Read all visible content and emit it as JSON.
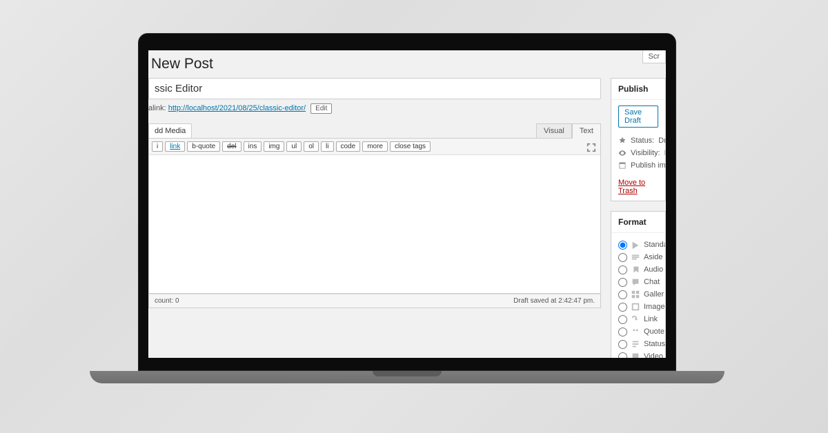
{
  "page": {
    "heading": "New Post",
    "screen_options": "Scr"
  },
  "post": {
    "title": "ssic Editor",
    "permalink_label": "alink:",
    "permalink_url": "http://localhost/2021/08/25/classic-editor/",
    "edit_label": "Edit"
  },
  "media": {
    "add_label": "dd Media"
  },
  "tabs": {
    "visual": "Visual",
    "text": "Text"
  },
  "toolbar": {
    "buttons": [
      "i",
      "link",
      "b-quote",
      "del",
      "ins",
      "img",
      "ul",
      "ol",
      "li",
      "code",
      "more",
      "close tags"
    ]
  },
  "status": {
    "word_count": "count: 0",
    "draft_saved": "Draft saved at 2:42:47 pm."
  },
  "publish": {
    "title": "Publish",
    "save_draft": "Save Draft",
    "status_label": "Status:",
    "status_value": "Dra",
    "visibility_label": "Visibility:",
    "visibility_value": "P",
    "publish_label": "Publish im",
    "trash": "Move to Trash"
  },
  "format": {
    "title": "Format",
    "options": [
      "Standa",
      "Aside",
      "Audio",
      "Chat",
      "Galler",
      "Image",
      "Link",
      "Quote",
      "Status",
      "Video"
    ],
    "selected": 0
  }
}
